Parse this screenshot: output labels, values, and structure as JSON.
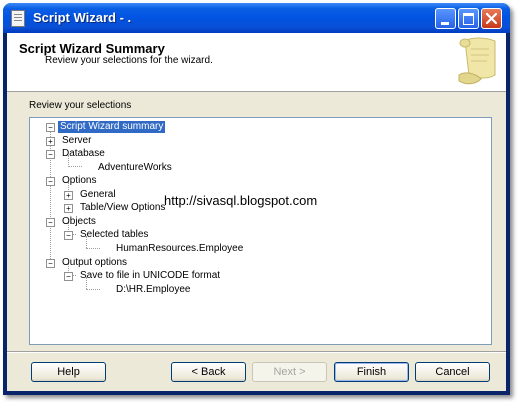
{
  "window": {
    "title": "Script Wizard - ."
  },
  "header": {
    "title": "Script Wizard Summary",
    "subtitle": "Review your selections for the wizard."
  },
  "section_label": "Review your selections",
  "tree": {
    "root": "Script Wizard summary",
    "server": "Server",
    "database": "Database",
    "database_name": "AdventureWorks",
    "options": "Options",
    "general": "General",
    "table_view_options": "Table/View Options",
    "objects": "Objects",
    "selected_tables": "Selected tables",
    "table_name": "HumanResources.Employee",
    "output_options": "Output options",
    "save_to_file": "Save to file in UNICODE format",
    "file_path": "D:\\HR.Employee"
  },
  "watermark": "http://sivasql.blogspot.com",
  "buttons": {
    "help": "Help",
    "back": "< Back",
    "next": "Next >",
    "finish": "Finish",
    "cancel": "Cancel"
  }
}
